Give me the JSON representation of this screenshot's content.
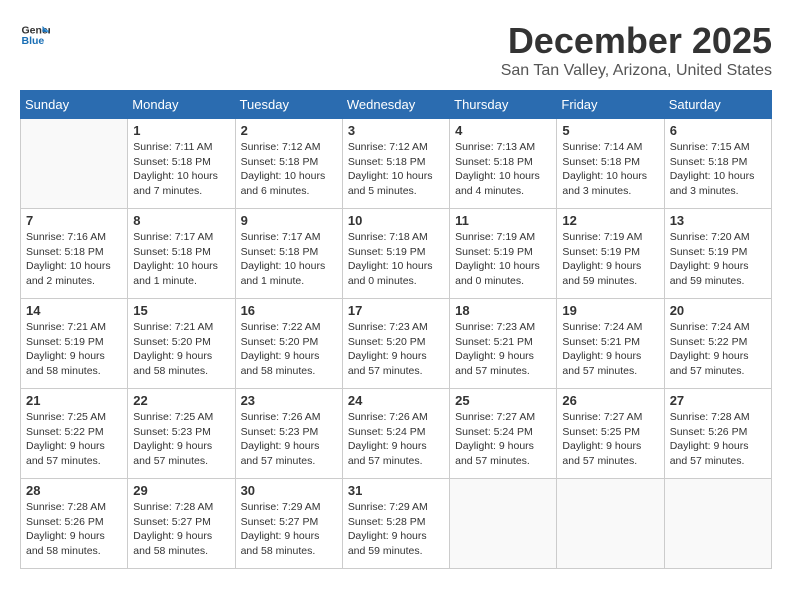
{
  "logo": {
    "line1": "General",
    "line2": "Blue"
  },
  "title": "December 2025",
  "location": "San Tan Valley, Arizona, United States",
  "days_of_week": [
    "Sunday",
    "Monday",
    "Tuesday",
    "Wednesday",
    "Thursday",
    "Friday",
    "Saturday"
  ],
  "weeks": [
    [
      {
        "day": "",
        "info": ""
      },
      {
        "day": "1",
        "info": "Sunrise: 7:11 AM\nSunset: 5:18 PM\nDaylight: 10 hours\nand 7 minutes."
      },
      {
        "day": "2",
        "info": "Sunrise: 7:12 AM\nSunset: 5:18 PM\nDaylight: 10 hours\nand 6 minutes."
      },
      {
        "day": "3",
        "info": "Sunrise: 7:12 AM\nSunset: 5:18 PM\nDaylight: 10 hours\nand 5 minutes."
      },
      {
        "day": "4",
        "info": "Sunrise: 7:13 AM\nSunset: 5:18 PM\nDaylight: 10 hours\nand 4 minutes."
      },
      {
        "day": "5",
        "info": "Sunrise: 7:14 AM\nSunset: 5:18 PM\nDaylight: 10 hours\nand 3 minutes."
      },
      {
        "day": "6",
        "info": "Sunrise: 7:15 AM\nSunset: 5:18 PM\nDaylight: 10 hours\nand 3 minutes."
      }
    ],
    [
      {
        "day": "7",
        "info": "Sunrise: 7:16 AM\nSunset: 5:18 PM\nDaylight: 10 hours\nand 2 minutes."
      },
      {
        "day": "8",
        "info": "Sunrise: 7:17 AM\nSunset: 5:18 PM\nDaylight: 10 hours\nand 1 minute."
      },
      {
        "day": "9",
        "info": "Sunrise: 7:17 AM\nSunset: 5:18 PM\nDaylight: 10 hours\nand 1 minute."
      },
      {
        "day": "10",
        "info": "Sunrise: 7:18 AM\nSunset: 5:19 PM\nDaylight: 10 hours\nand 0 minutes."
      },
      {
        "day": "11",
        "info": "Sunrise: 7:19 AM\nSunset: 5:19 PM\nDaylight: 10 hours\nand 0 minutes."
      },
      {
        "day": "12",
        "info": "Sunrise: 7:19 AM\nSunset: 5:19 PM\nDaylight: 9 hours\nand 59 minutes."
      },
      {
        "day": "13",
        "info": "Sunrise: 7:20 AM\nSunset: 5:19 PM\nDaylight: 9 hours\nand 59 minutes."
      }
    ],
    [
      {
        "day": "14",
        "info": "Sunrise: 7:21 AM\nSunset: 5:19 PM\nDaylight: 9 hours\nand 58 minutes."
      },
      {
        "day": "15",
        "info": "Sunrise: 7:21 AM\nSunset: 5:20 PM\nDaylight: 9 hours\nand 58 minutes."
      },
      {
        "day": "16",
        "info": "Sunrise: 7:22 AM\nSunset: 5:20 PM\nDaylight: 9 hours\nand 58 minutes."
      },
      {
        "day": "17",
        "info": "Sunrise: 7:23 AM\nSunset: 5:20 PM\nDaylight: 9 hours\nand 57 minutes."
      },
      {
        "day": "18",
        "info": "Sunrise: 7:23 AM\nSunset: 5:21 PM\nDaylight: 9 hours\nand 57 minutes."
      },
      {
        "day": "19",
        "info": "Sunrise: 7:24 AM\nSunset: 5:21 PM\nDaylight: 9 hours\nand 57 minutes."
      },
      {
        "day": "20",
        "info": "Sunrise: 7:24 AM\nSunset: 5:22 PM\nDaylight: 9 hours\nand 57 minutes."
      }
    ],
    [
      {
        "day": "21",
        "info": "Sunrise: 7:25 AM\nSunset: 5:22 PM\nDaylight: 9 hours\nand 57 minutes."
      },
      {
        "day": "22",
        "info": "Sunrise: 7:25 AM\nSunset: 5:23 PM\nDaylight: 9 hours\nand 57 minutes."
      },
      {
        "day": "23",
        "info": "Sunrise: 7:26 AM\nSunset: 5:23 PM\nDaylight: 9 hours\nand 57 minutes."
      },
      {
        "day": "24",
        "info": "Sunrise: 7:26 AM\nSunset: 5:24 PM\nDaylight: 9 hours\nand 57 minutes."
      },
      {
        "day": "25",
        "info": "Sunrise: 7:27 AM\nSunset: 5:24 PM\nDaylight: 9 hours\nand 57 minutes."
      },
      {
        "day": "26",
        "info": "Sunrise: 7:27 AM\nSunset: 5:25 PM\nDaylight: 9 hours\nand 57 minutes."
      },
      {
        "day": "27",
        "info": "Sunrise: 7:28 AM\nSunset: 5:26 PM\nDaylight: 9 hours\nand 57 minutes."
      }
    ],
    [
      {
        "day": "28",
        "info": "Sunrise: 7:28 AM\nSunset: 5:26 PM\nDaylight: 9 hours\nand 58 minutes."
      },
      {
        "day": "29",
        "info": "Sunrise: 7:28 AM\nSunset: 5:27 PM\nDaylight: 9 hours\nand 58 minutes."
      },
      {
        "day": "30",
        "info": "Sunrise: 7:29 AM\nSunset: 5:27 PM\nDaylight: 9 hours\nand 58 minutes."
      },
      {
        "day": "31",
        "info": "Sunrise: 7:29 AM\nSunset: 5:28 PM\nDaylight: 9 hours\nand 59 minutes."
      },
      {
        "day": "",
        "info": ""
      },
      {
        "day": "",
        "info": ""
      },
      {
        "day": "",
        "info": ""
      }
    ]
  ]
}
